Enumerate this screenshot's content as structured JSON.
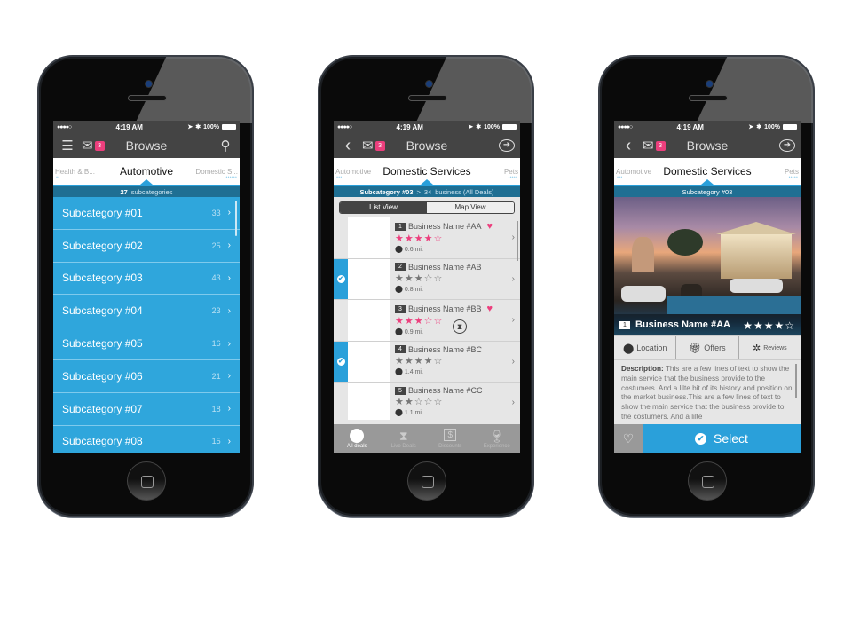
{
  "status": {
    "signal": "●●●●○",
    "wifi": "wifi-icon",
    "time": "4:19 AM",
    "location": "location-arrow-icon",
    "bluetooth": "bluetooth-icon",
    "battery": "100%"
  },
  "nav": {
    "title": "Browse",
    "badge": "3"
  },
  "icons": {
    "menu": "☰",
    "mail": "✉",
    "search": "⚲",
    "back": "‹",
    "share": "➜",
    "chevron": "›",
    "heart": "♥",
    "heart_outline": "♡",
    "pin": "⚲",
    "check": "✔",
    "hourglass": "⧗",
    "star_full": "★",
    "star_empty": "☆"
  },
  "screen1": {
    "tabs": {
      "left": "Health & B...",
      "center": "Automotive",
      "right": "Domestic S..."
    },
    "dots_left": "••",
    "dots_right": "••••••",
    "sub_count": "27",
    "sub_label": "subcategories",
    "items": [
      {
        "label": "Subcategory #01",
        "count": "33"
      },
      {
        "label": "Subcategory #02",
        "count": "25"
      },
      {
        "label": "Subcategory #03",
        "count": "43"
      },
      {
        "label": "Subcategory #04",
        "count": "23"
      },
      {
        "label": "Subcategory #05",
        "count": "16"
      },
      {
        "label": "Subcategory #06",
        "count": "21"
      },
      {
        "label": "Subcategory #07",
        "count": "18"
      },
      {
        "label": "Subcategory #08",
        "count": "15"
      }
    ]
  },
  "screen2": {
    "tabs": {
      "left": "Automotive",
      "center": "Domestic Services",
      "right": "Pets"
    },
    "dots_left": "•••",
    "dots_right": "•••••",
    "breadcrumb": {
      "sub": "Subcategory #03",
      "sep": ">",
      "count": "34",
      "label": "business (All Deals)"
    },
    "views": {
      "list": "List View",
      "map": "Map View"
    },
    "businesses": [
      {
        "num": "1",
        "name": "Business Name #AA",
        "stars": "★★★★☆",
        "rating": 4,
        "favorite": true,
        "selected": false,
        "distance": "0.6 mi.",
        "live": false
      },
      {
        "num": "2",
        "name": "Business Name #AB",
        "stars": "★★★☆☆",
        "rating": 3,
        "favorite": false,
        "selected": true,
        "distance": "0.8 mi.",
        "live": false
      },
      {
        "num": "3",
        "name": "Business Name #BB",
        "stars": "★★★☆☆",
        "rating": 3,
        "favorite": true,
        "selected": false,
        "distance": "0.9 mi.",
        "live": true
      },
      {
        "num": "4",
        "name": "Business Name #BC",
        "stars": "★★★★☆",
        "rating": 4,
        "favorite": false,
        "selected": true,
        "distance": "1.4 mi.",
        "live": false
      },
      {
        "num": "5",
        "name": "Business Name #CC",
        "stars": "★★☆☆☆",
        "rating": 2,
        "favorite": false,
        "selected": false,
        "distance": "1.1 mi.",
        "live": false
      }
    ],
    "tabbar": [
      {
        "label": "All deals",
        "icon": ""
      },
      {
        "label": "Live Deals",
        "icon": "⧗"
      },
      {
        "label": "Discounts",
        "icon": "$"
      },
      {
        "label": "Experience",
        "icon": "🍷"
      }
    ]
  },
  "screen3": {
    "tabs": {
      "left": "Automotive",
      "center": "Domestic Services",
      "right": "Pets"
    },
    "dots_left": "•••",
    "dots_right": "•••••",
    "sub": "Subcategory #03",
    "business": {
      "num": "1",
      "name": "Business Name #AA",
      "stars": "★★★★☆",
      "rating": 4
    },
    "actions": {
      "location": "Location",
      "offers": "Offers",
      "reviews": "Reviews"
    },
    "action_icons": {
      "location": "⚲",
      "offers": "🎁",
      "reviews": "✲"
    },
    "desc_label": "Description:",
    "desc_text": "This are a few lines of text to show the main service that the business provide to the costumers. And a lilte bit of its history and position on the market business.This are a few lines of text to show the main service that the business provide to the costumers. And a lilte",
    "select_label": "Select"
  },
  "colors": {
    "accent": "#2aa0da",
    "pink": "#ec3f7d",
    "navbar": "#444444",
    "subbar": "#1f6f93"
  }
}
